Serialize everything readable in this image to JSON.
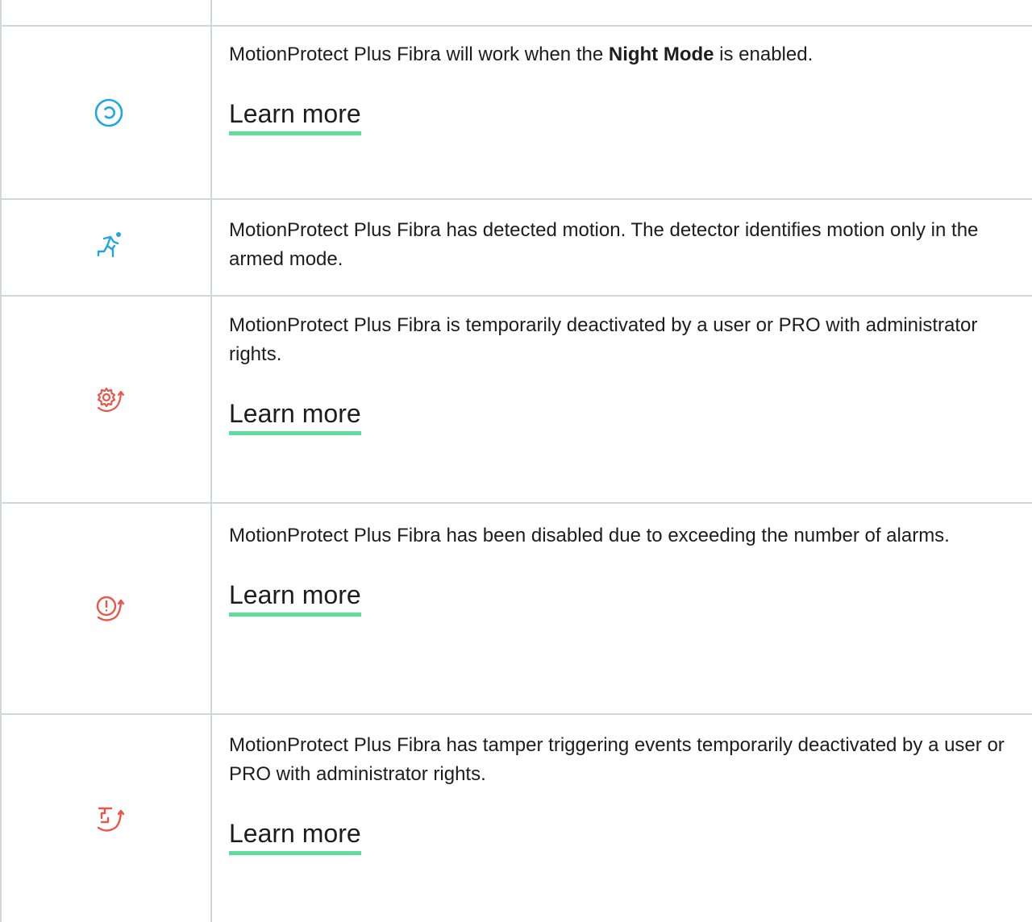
{
  "rows": [
    {
      "icon": "night-mode-icon",
      "icon_color": "#1fa6e3",
      "text_before": "MotionProtect Plus Fibra will work when the ",
      "text_bold": "Night Mode",
      "text_after": " is enabled.",
      "link": "Learn more"
    },
    {
      "icon": "motion-detected-icon",
      "icon_color": "#1fa6e3",
      "text": "MotionProtect Plus Fibra has detected motion. The detector identifies motion only in the armed mode."
    },
    {
      "icon": "temporarily-deactivated-icon",
      "icon_color": "#e8584a",
      "text": "MotionProtect Plus Fibra is temporarily deactivated by a user or PRO with administrator rights.",
      "link": "Learn more"
    },
    {
      "icon": "alarm-limit-disabled-icon",
      "icon_color": "#e8584a",
      "text": "MotionProtect Plus Fibra has been disabled due to exceeding the number of alarms.",
      "link": "Learn more"
    },
    {
      "icon": "tamper-deactivated-icon",
      "icon_color": "#e8584a",
      "text": "MotionProtect Plus Fibra has tamper triggering events temporarily deactivated by a user or PRO with administrator rights.",
      "link": "Learn more"
    }
  ],
  "colors": {
    "border": "#d3d6d9",
    "link_underline": "#5fdc9e"
  }
}
